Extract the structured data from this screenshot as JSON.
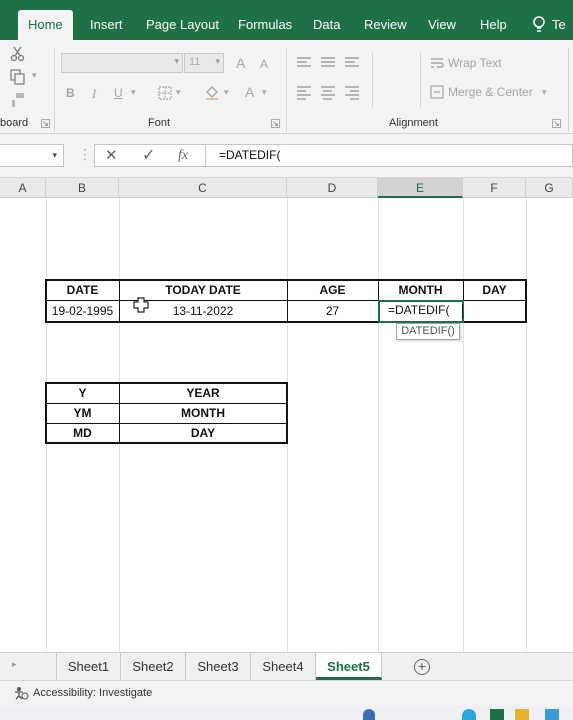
{
  "menu": {
    "tabs": [
      "Home",
      "Insert",
      "Page Layout",
      "Formulas",
      "Data",
      "Review",
      "View",
      "Help",
      "Te"
    ],
    "active": "Home"
  },
  "ribbon": {
    "clipboard_label": "board",
    "font_label": "Font",
    "alignment_label": "Alignment",
    "font_size": "11",
    "bold": "B",
    "italic": "I",
    "underline": "U",
    "grow_font": "A",
    "shrink_font": "A",
    "font_color": "A",
    "wrap_text": "Wrap Text",
    "merge_center": "Merge & Center"
  },
  "formula_bar": {
    "cancel": "✕",
    "enter": "✓",
    "fx": "fx",
    "content": "=DATEDIF("
  },
  "columns": [
    "A",
    "B",
    "C",
    "D",
    "E",
    "F",
    "G"
  ],
  "selected_column": "E",
  "table1": {
    "headers": [
      "DATE",
      "TODAY DATE",
      "AGE",
      "MONTH",
      "DAY"
    ],
    "row": [
      "19-02-1995",
      "13-11-2022",
      "27",
      "=DATEDIF(",
      ""
    ]
  },
  "tooltip": "DATEDIF()",
  "table2": {
    "rows": [
      [
        "Y",
        "YEAR"
      ],
      [
        "YM",
        "MONTH"
      ],
      [
        "MD",
        "DAY"
      ]
    ]
  },
  "sheets": {
    "tabs": [
      "Sheet1",
      "Sheet2",
      "Sheet3",
      "Sheet4",
      "Sheet5"
    ],
    "active": "Sheet5",
    "add": "+"
  },
  "status": {
    "accessibility": "Accessibility: Investigate"
  },
  "colors": {
    "excel_green": "#1e7145",
    "ribbon_bg": "#f3f3f3"
  }
}
